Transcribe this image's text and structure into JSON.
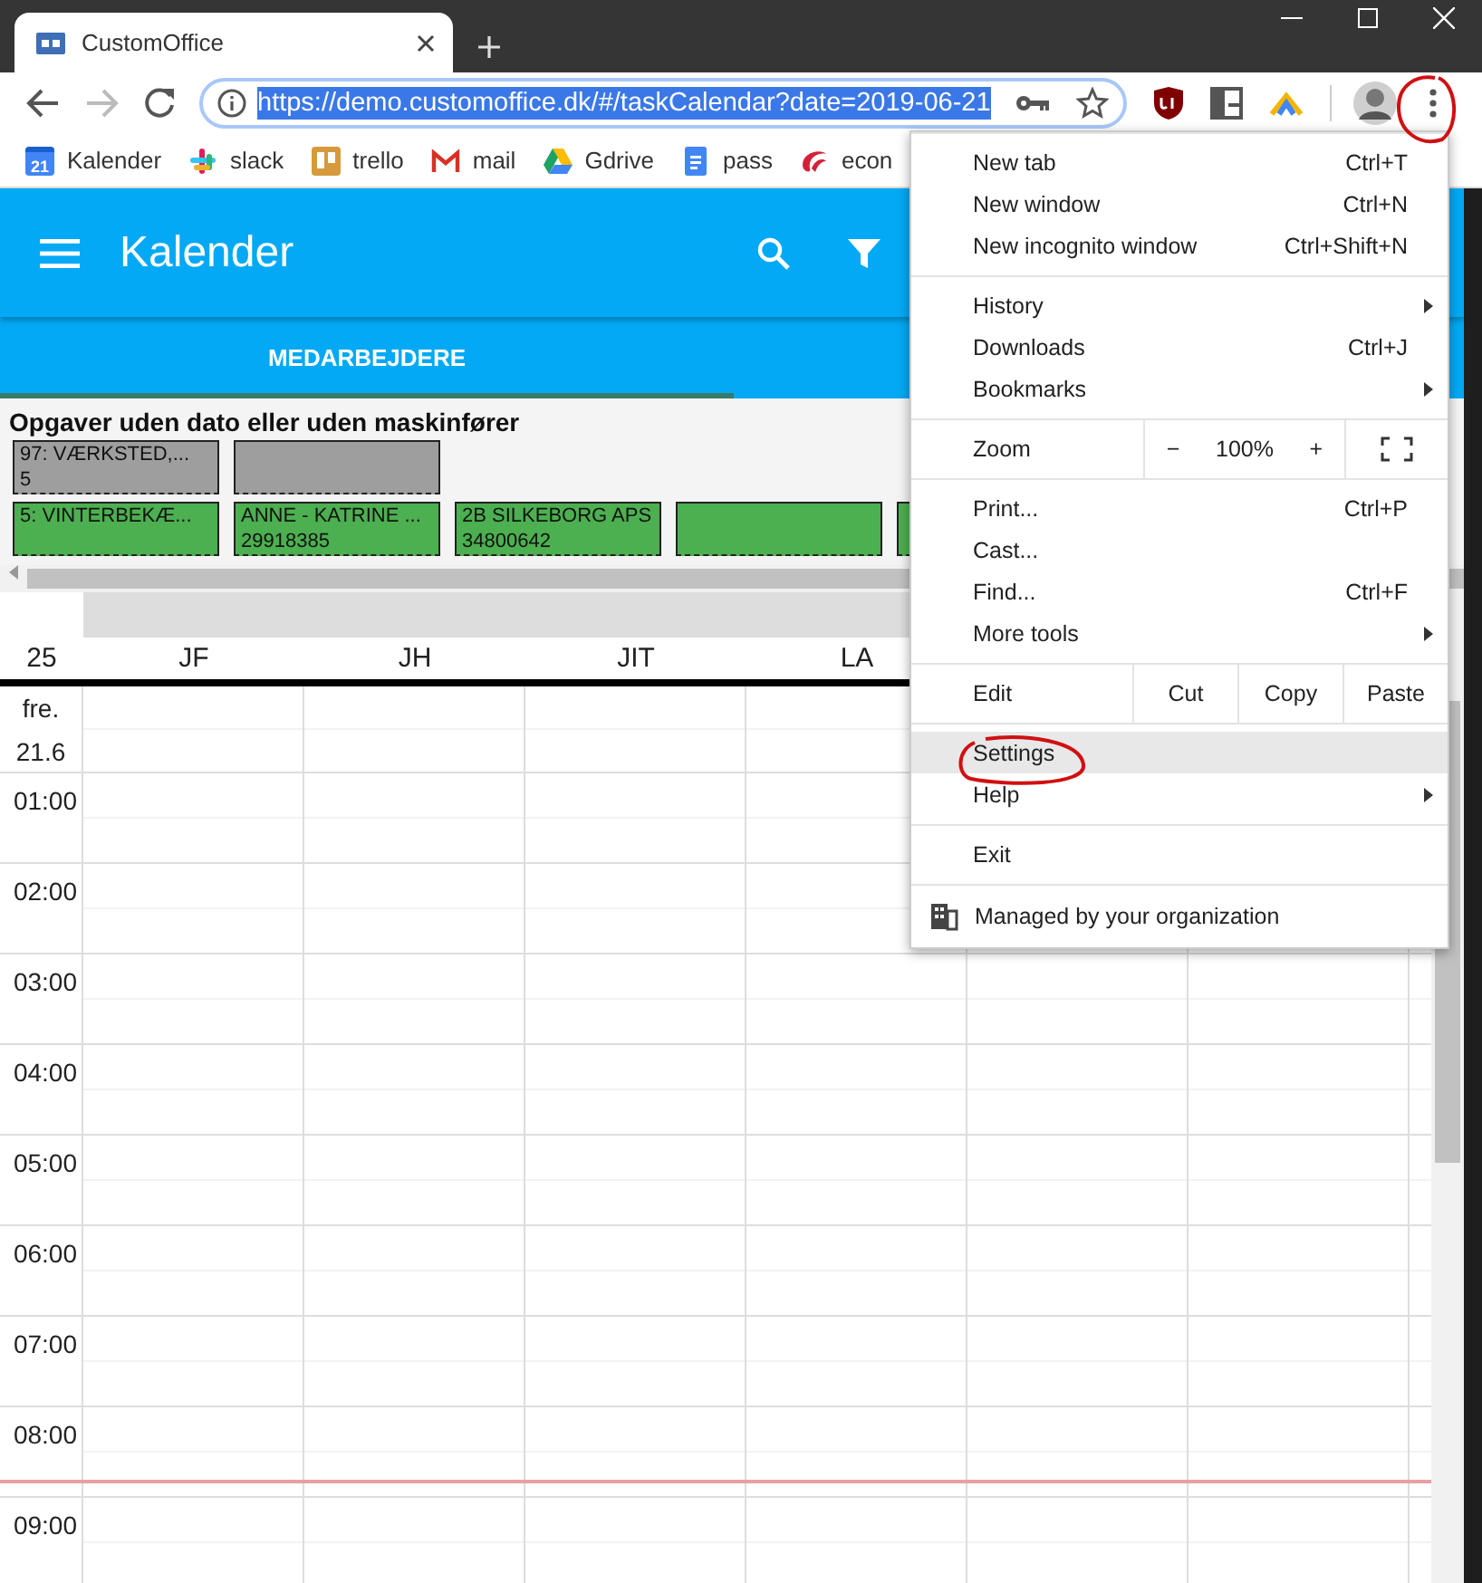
{
  "browser": {
    "tab": {
      "title": "CustomOffice"
    },
    "back": {
      "disabled": false
    },
    "forward": {
      "disabled": true
    },
    "url": "https://demo.customoffice.dk/#/taskCalendar?date=2019-06-21",
    "bookmarks": [
      {
        "kind": "calendar",
        "icon_text": "21",
        "label": "Kalender"
      },
      {
        "kind": "slack",
        "label": "slack"
      },
      {
        "kind": "trello",
        "label": "trello"
      },
      {
        "kind": "mail",
        "label": "mail"
      },
      {
        "kind": "drive",
        "label": "Gdrive"
      },
      {
        "kind": "doc",
        "label": "pass"
      },
      {
        "kind": "econ",
        "label": "econ"
      }
    ]
  },
  "app": {
    "title": "Kalender",
    "tabs": [
      {
        "label": "MEDARBEJDERE",
        "selected": true
      }
    ],
    "task_pool": {
      "title": "Opgaver uden dato eller uden maskinfører",
      "rows": [
        [
          {
            "lines": [
              "97: VÆRKSTED,...",
              "5"
            ],
            "color": "#9e9e9e"
          },
          {
            "color": "#9e9e9e"
          }
        ],
        [
          {
            "lines": [
              "5: VINTERBEKÆ..."
            ],
            "color": "#4caf50"
          },
          {
            "lines": [
              "ANNE - KATRINE ...",
              "29918385"
            ],
            "color": "#4caf50"
          },
          {
            "lines": [
              "2B SILKEBORG APS",
              "34800642"
            ],
            "color": "#4caf50"
          },
          {
            "color": "#4caf50"
          },
          {
            "color": "#4caf50"
          }
        ]
      ]
    },
    "calendar": {
      "week": "25",
      "columns": [
        "JF",
        "JH",
        "JIT",
        "LA"
      ],
      "day": {
        "weekday": "fre.",
        "date": "21.6"
      },
      "hours": [
        "01:00",
        "02:00",
        "03:00",
        "04:00",
        "05:00",
        "06:00",
        "07:00",
        "08:00",
        "09:00"
      ]
    }
  },
  "menu": {
    "groups": [
      {
        "kind": "items",
        "items": [
          {
            "label": "New tab",
            "shortcut": "Ctrl+T",
            "submenu": false,
            "highlighted": false
          },
          {
            "label": "New window",
            "shortcut": "Ctrl+N",
            "submenu": false,
            "highlighted": false
          },
          {
            "label": "New incognito window",
            "shortcut": "Ctrl+Shift+N",
            "submenu": false,
            "highlighted": false
          }
        ]
      },
      {
        "kind": "items",
        "items": [
          {
            "label": "History",
            "submenu": true,
            "highlighted": false
          },
          {
            "label": "Downloads",
            "shortcut": "Ctrl+J",
            "submenu": false,
            "highlighted": false
          },
          {
            "label": "Bookmarks",
            "submenu": true,
            "highlighted": false
          }
        ]
      },
      {
        "kind": "zoom",
        "label": "Zoom",
        "minus": "−",
        "value": "100%",
        "plus": "+"
      },
      {
        "kind": "items",
        "items": [
          {
            "label": "Print...",
            "shortcut": "Ctrl+P",
            "submenu": false,
            "highlighted": false
          },
          {
            "label": "Cast...",
            "submenu": false,
            "highlighted": false
          },
          {
            "label": "Find...",
            "shortcut": "Ctrl+F",
            "submenu": false,
            "highlighted": false
          },
          {
            "label": "More tools",
            "submenu": true,
            "highlighted": false
          }
        ]
      },
      {
        "kind": "edit",
        "label": "Edit",
        "buttons": [
          "Cut",
          "Copy",
          "Paste"
        ]
      },
      {
        "kind": "items",
        "items": [
          {
            "label": "Settings",
            "submenu": false,
            "highlighted": true
          },
          {
            "label": "Help",
            "submenu": true,
            "highlighted": false
          }
        ]
      },
      {
        "kind": "items",
        "items": [
          {
            "label": "Exit",
            "submenu": false,
            "highlighted": false
          }
        ]
      },
      {
        "kind": "note",
        "label": "Managed by your organization"
      }
    ]
  }
}
